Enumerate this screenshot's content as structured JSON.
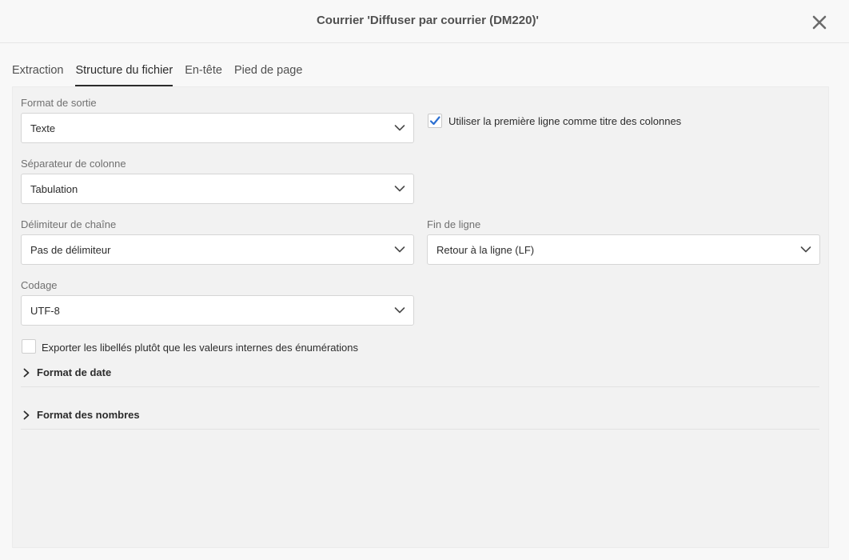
{
  "header": {
    "title": "Courrier 'Diffuser par courrier (DM220)'"
  },
  "tabs": [
    {
      "label": "Extraction"
    },
    {
      "label": "Structure du fichier"
    },
    {
      "label": "En-tête"
    },
    {
      "label": "Pied de page"
    }
  ],
  "form": {
    "output_format": {
      "label": "Format de sortie",
      "value": "Texte"
    },
    "first_line_titles": {
      "label": "Utiliser la première ligne comme titre des colonnes",
      "checked": true
    },
    "column_separator": {
      "label": "Séparateur de colonne",
      "value": "Tabulation"
    },
    "string_delimiter": {
      "label": "Délimiteur de chaîne",
      "value": "Pas de délimiteur"
    },
    "line_ending": {
      "label": "Fin de ligne",
      "value": "Retour à la ligne (LF)"
    },
    "encoding": {
      "label": "Codage",
      "value": "UTF-8"
    },
    "export_labels": {
      "label": "Exporter les libellés plutôt que les valeurs internes des énumérations",
      "checked": false
    }
  },
  "sections": [
    {
      "title": "Format de date"
    },
    {
      "title": "Format des nombres"
    }
  ],
  "colors": {
    "accent": "#2c6fd1",
    "panel": "#f2f2f2",
    "text": "#2c2c2c",
    "label": "#707070"
  },
  "icons": {
    "close": "close-icon",
    "select": "chevron-down-icon",
    "section": "chevron-right-icon",
    "check": "checkmark-icon"
  }
}
